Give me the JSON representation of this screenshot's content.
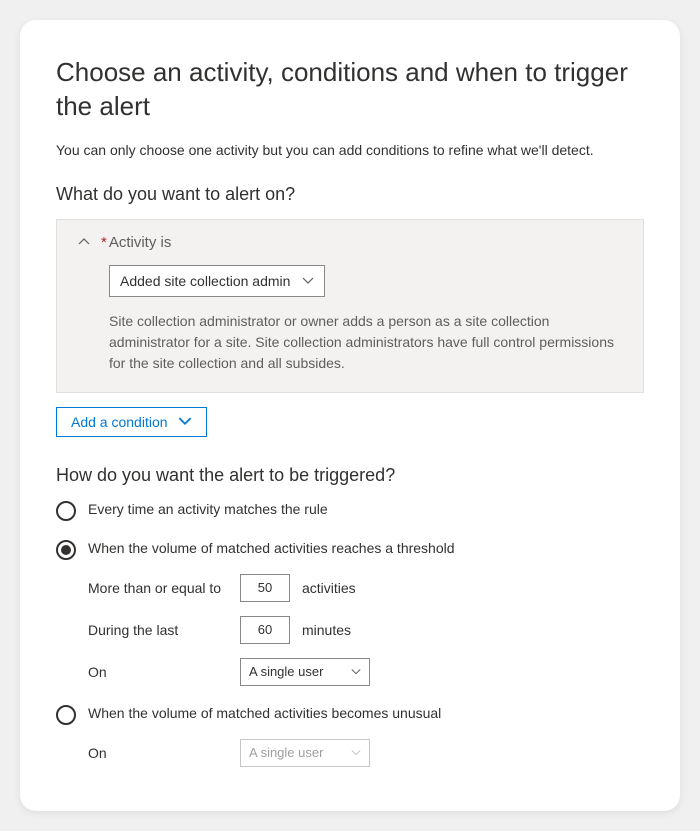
{
  "header": {
    "title": "Choose an activity, conditions and when to trigger the alert",
    "subtitle": "You can only choose one activity but you can add conditions to refine what we'll detect."
  },
  "alert_on": {
    "heading": "What do you want to alert on?",
    "activity_label": "Activity is",
    "activity_value": "Added site collection admin",
    "activity_description": "Site collection administrator or owner adds a person as a site collection administrator for a site. Site collection administrators have full control permissions for the site collection and all subsides.",
    "add_condition_label": "Add a condition"
  },
  "trigger": {
    "heading": "How do you want the alert to be triggered?",
    "options": {
      "every_time": "Every time an activity matches the rule",
      "threshold": "When the volume of matched activities reaches a threshold",
      "unusual": "When the volume of matched activities becomes unusual"
    },
    "threshold_fields": {
      "more_than_label": "More than or equal to",
      "more_than_value": "50",
      "more_than_unit": "activities",
      "during_label": "During the last",
      "during_value": "60",
      "during_unit": "minutes",
      "on_label": "On",
      "on_value": "A single user"
    },
    "unusual_fields": {
      "on_label": "On",
      "on_value": "A single user"
    }
  }
}
